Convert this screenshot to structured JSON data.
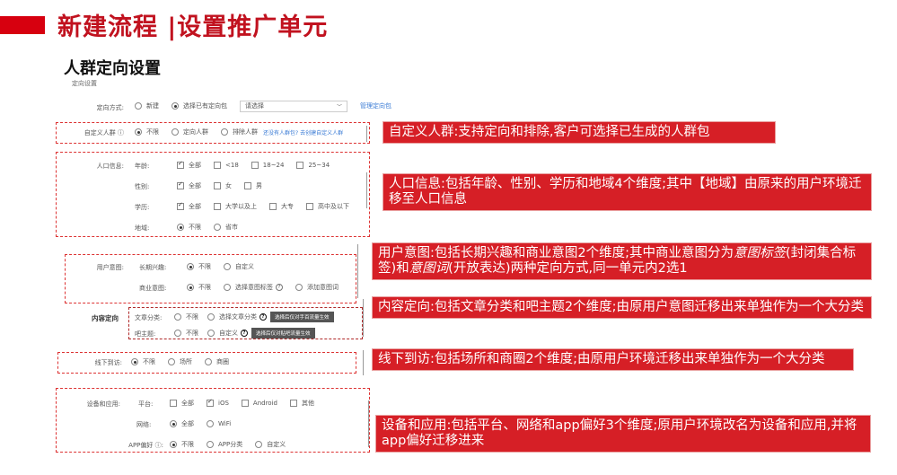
{
  "slide": {
    "title": "新建流程 |设置推广单元",
    "section_title": "人群定向设置",
    "section_subtitle": "定向设置"
  },
  "form": {
    "targeting_method": {
      "label": "定向方式:",
      "opt_new": "新建",
      "opt_existing": "选择已有定向包",
      "select_placeholder": "请选择",
      "manage_link": "管理定向包"
    },
    "custom_audience": {
      "label": "自定义人群 ⓘ",
      "opt_none": "不限",
      "opt_target": "定向人群",
      "opt_exclude": "排除人群",
      "link_text": "还没有人群包? 去创建自定义人群"
    },
    "demographics": {
      "label": "人口信息:",
      "age_label": "年龄:",
      "age_all": "全部",
      "age_lt18": "<18",
      "age_18_24": "18~24",
      "age_25_34": "25~34",
      "gender_label": "性别:",
      "gender_all": "全部",
      "gender_f": "女",
      "gender_m": "男",
      "edu_label": "学历:",
      "edu_all": "全部",
      "edu_bachelor": "大学以及上",
      "edu_college": "大专",
      "edu_high": "高中及以下",
      "region_label": "地域:",
      "region_none": "不限",
      "region_province": "省市"
    },
    "intent": {
      "label": "用户意图:",
      "long_label": "长期兴趣:",
      "long_none": "不限",
      "long_custom": "自定义",
      "biz_label": "商业意图:",
      "biz_none": "不限",
      "biz_tags": "选择意图标签",
      "biz_words": "添加意图词"
    },
    "content": {
      "label": "内容定向",
      "article_label": "文章分类:",
      "article_none": "不限",
      "article_choose": "选择文章分类",
      "article_tip": "选择后仅对手百流量生效",
      "bar_label": "吧主题:",
      "bar_none": "不限",
      "bar_custom": "自定义",
      "bar_tip": "选择后仅对贴吧流量生效"
    },
    "offline": {
      "label": "线下到访:",
      "opt_none": "不限",
      "opt_venue": "场所",
      "opt_district": "商圈"
    },
    "device": {
      "label": "设备和应用:",
      "platform_label": "平台:",
      "p_all": "全部",
      "p_ios": "iOS",
      "p_android": "Android",
      "p_other": "其他",
      "network_label": "网络:",
      "n_all": "全部",
      "n_wifi": "WiFi",
      "app_label": "APP偏好 ⓘ:",
      "app_none": "不限",
      "app_category": "APP分类",
      "app_custom": "自定义"
    }
  },
  "callouts": {
    "custom_audience": "自定义人群:支持定向和排除,客户可选择已生成的人群包",
    "demographics": "人口信息:包括年龄、性别、学历和地域4个维度;其中【地域】由原来的用户环境迁移至人口信息",
    "intent_a": "用户意图:包括长期兴趣和商业意图2个维度;其中商业意图分为",
    "intent_b": "意图标签",
    "intent_c": "(封闭集合标签)和",
    "intent_d": "意图词",
    "intent_e": "(开放表达)两种定向方式,同一单元内2选1",
    "content": "内容定向:包括文章分类和吧主题2个维度;由原用户意图迁移出来单独作为一个大分类",
    "offline": "线下到访:包括场所和商圈2个维度;由原用户环境迁移出来单独作为一个大分类",
    "device": "设备和应用:包括平台、网络和app偏好3个维度;原用户环境改名为设备和应用,并将app偏好迁移进来"
  },
  "colors": {
    "title_red": "#c1121f",
    "callout_red": "#d61f26",
    "accent_bar": "#d7000f"
  }
}
